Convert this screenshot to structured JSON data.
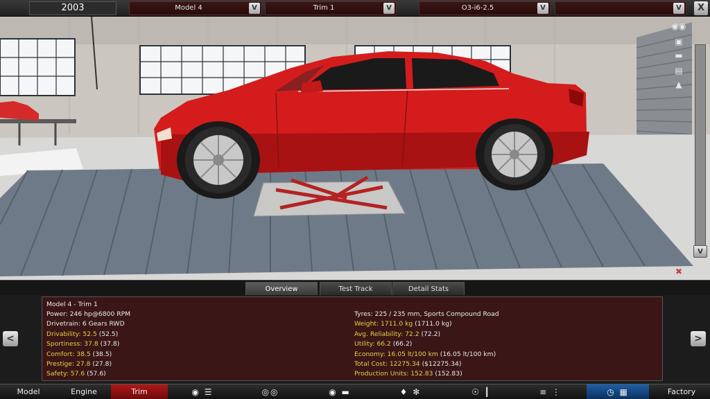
{
  "top_bar": {
    "year": "2003",
    "model": "Model 4",
    "trim": "Trim 1",
    "engine": "O3-i6-2.5",
    "extra": "",
    "dropdown_glyph": "V",
    "close_glyph": "X"
  },
  "view_icons": [
    "camera-icon",
    "eye-icon",
    "car-front-icon",
    "car-side-icon",
    "car-top-icon",
    "car-angle-icon"
  ],
  "rail": {
    "down_glyph": "V"
  },
  "tabs": [
    {
      "label": "Overview",
      "active": true
    },
    {
      "label": "Test Track",
      "active": false
    },
    {
      "label": "Detail Stats",
      "active": false
    }
  ],
  "panel": {
    "title": "Model 4 - Trim 1",
    "left_rows": [
      {
        "label": "Power: 246 hp@6800 RPM",
        "paren": "",
        "highlight": false
      },
      {
        "label": "Drivetrain: 6 Gears RWD",
        "paren": "",
        "highlight": false
      },
      {
        "label": "Drivability: 52.5",
        "paren": " (52.5)",
        "highlight": true
      },
      {
        "label": "Sportiness: 37.8",
        "paren": " (37.8)",
        "highlight": true
      },
      {
        "label": "Comfort: 38.5",
        "paren": " (38.5)",
        "highlight": true
      },
      {
        "label": "Prestige: 27.8",
        "paren": " (27.8)",
        "highlight": true
      },
      {
        "label": "Safety: 57.6",
        "paren": " (57.6)",
        "highlight": true
      }
    ],
    "right_rows": [
      {
        "label": "Tyres: 225 / 235 mm, Sports Compound Road",
        "paren": "",
        "highlight": false
      },
      {
        "label": "Weight: 1711.0 kg",
        "paren": " (1711.0 kg)",
        "highlight": true
      },
      {
        "label": "Avg. Reliability: 72.2",
        "paren": " (72.2)",
        "highlight": true
      },
      {
        "label": "Utility: 66.2",
        "paren": " (66.2)",
        "highlight": true
      },
      {
        "label": "Economy: 16.05 lt/100 km",
        "paren": " (16.05 lt/100 km)",
        "highlight": true
      },
      {
        "label": "Total Cost: 12275.34",
        "paren": " ($12275.34)",
        "highlight": true
      },
      {
        "label": "Production Units: 152.83",
        "paren": " (152.83)",
        "highlight": true
      }
    ],
    "prev_glyph": "<",
    "next_glyph": ">"
  },
  "bottom_nav": {
    "model": "Model",
    "engine": "Engine",
    "trim": "Trim",
    "factory": "Factory",
    "icons": [
      "chassis-icon",
      "wheels-icon",
      "body-icon",
      "car-body-icon",
      "interior-icon",
      "suspension-icon",
      "test-drive-icon"
    ]
  },
  "colors": {
    "accent_red": "#b01818",
    "highlight_yellow": "#e8d04a",
    "car_red": "#d41c1c"
  }
}
